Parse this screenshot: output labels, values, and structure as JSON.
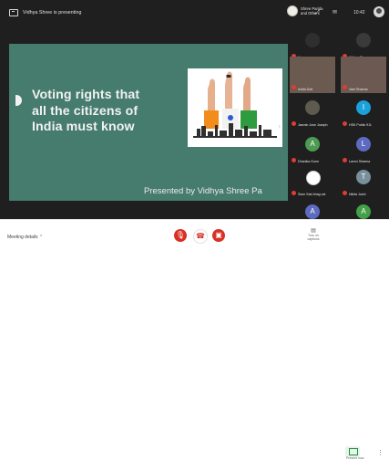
{
  "top": {
    "presenting_text": "Vidhya Shree is presenting",
    "chip_text": "Shree Parida and Others",
    "clock": "10:42"
  },
  "slide": {
    "title_lines": [
      "Voting rights that",
      "all the citizens of",
      "India must know"
    ],
    "footer": "Presented by Vidhya Shree Pa"
  },
  "participants": [
    {
      "name": "You",
      "type": "photo",
      "color": "#2f2f2f"
    },
    {
      "name": "Vidhya Shree",
      "type": "photo",
      "color": "#3a3a3a"
    },
    {
      "name": "Ishita Dutt",
      "type": "video",
      "color": "#6b5a4f"
    },
    {
      "name": "Vani Sharma",
      "type": "video",
      "color": "#6c5a52"
    },
    {
      "name": "Jasmin Jose Joseph",
      "type": "photo",
      "color": "#5f5a4f"
    },
    {
      "name": "HSK Public 911",
      "type": "letter",
      "letter": "I",
      "color": "#1aa1d9"
    },
    {
      "name": "Dhanika Gunn",
      "type": "letter",
      "letter": "A",
      "color": "#4d9a52"
    },
    {
      "name": "Laxmi Sharma",
      "type": "letter",
      "letter": "L",
      "color": "#5c6bc0"
    },
    {
      "name": "Siam Sab bhag vat",
      "type": "photo",
      "color": "#d8d8d8"
    },
    {
      "name": "Nikita Joshi",
      "type": "letter",
      "letter": "T",
      "color": "#78909c"
    },
    {
      "name": "Gyanika Nandak",
      "type": "letter",
      "letter": "A",
      "color": "#5c6bc0"
    },
    {
      "name": "Ayush Jonha",
      "type": "letter",
      "letter": "A",
      "color": "#43a047"
    }
  ],
  "bottom": {
    "meeting_details": "Meeting details",
    "turn_on_captions": "Turn on captions",
    "present_now": "Present now"
  }
}
